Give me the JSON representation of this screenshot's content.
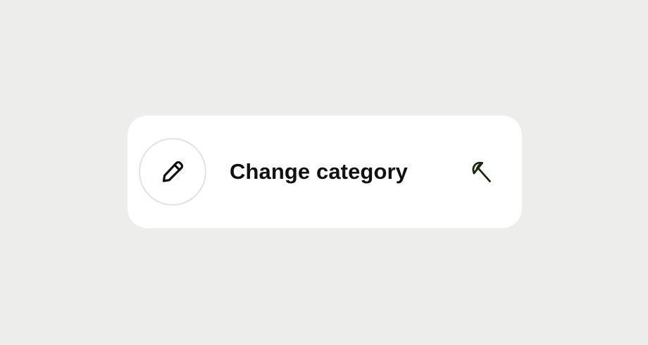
{
  "action": {
    "label": "Change category",
    "leading_icon": "pencil-icon",
    "trailing_icon": "beach-umbrella-icon"
  },
  "colors": {
    "background": "#edeeec",
    "card": "#ffffff",
    "text": "#111111",
    "icon_dark": "#111111",
    "category_icon": "#1b2a10",
    "circle_border": "#e2e2e2"
  }
}
